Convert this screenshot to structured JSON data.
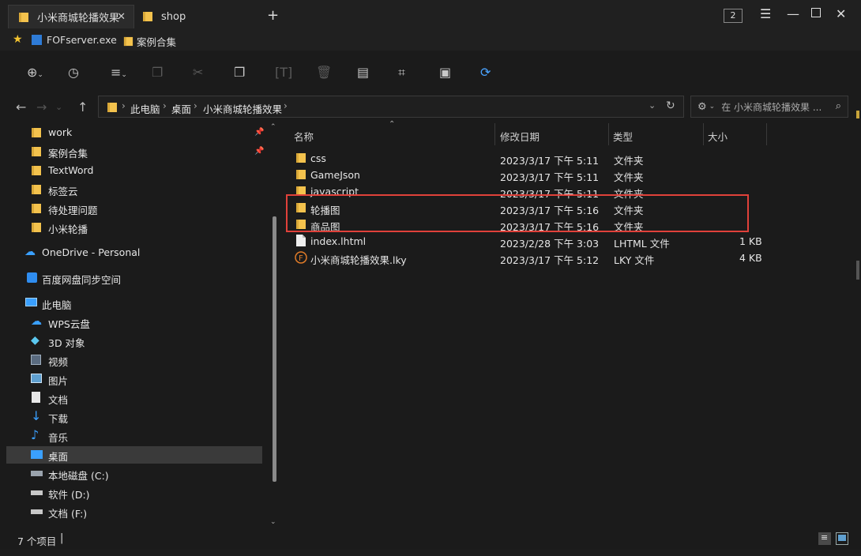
{
  "tabs": [
    {
      "label": "小米商城轮播效果"
    },
    {
      "label": "shop"
    }
  ],
  "window": {
    "count_badge": "2"
  },
  "bookmarks": [
    {
      "label": "FOFserver.exe"
    },
    {
      "label": "案例合集"
    }
  ],
  "breadcrumbs": [
    "此电脑",
    "桌面",
    "小米商城轮播效果"
  ],
  "search": {
    "placeholder": "在 小米商城轮播效果 ..."
  },
  "sidebar": {
    "items": [
      {
        "label": "work",
        "pinned": true
      },
      {
        "label": "案例合集",
        "pinned": true
      },
      {
        "label": "TextWord"
      },
      {
        "label": "标签云"
      },
      {
        "label": "待处理问题"
      },
      {
        "label": "小米轮播"
      },
      {
        "label": "OneDrive - Personal"
      },
      {
        "label": "百度网盘同步空间"
      },
      {
        "label": "此电脑"
      },
      {
        "label": "WPS云盘"
      },
      {
        "label": "3D 对象"
      },
      {
        "label": "视频"
      },
      {
        "label": "图片"
      },
      {
        "label": "文档"
      },
      {
        "label": "下载"
      },
      {
        "label": "音乐"
      },
      {
        "label": "桌面",
        "selected": true
      },
      {
        "label": "本地磁盘 (C:)"
      },
      {
        "label": "软件 (D:)"
      },
      {
        "label": "文档 (F:)"
      }
    ]
  },
  "columns": {
    "name": "名称",
    "date": "修改日期",
    "type": "类型",
    "size": "大小"
  },
  "files": [
    {
      "name": "css",
      "date": "2023/3/17 下午 5:11",
      "type": "文件夹",
      "size": "",
      "icon": "folder-icon"
    },
    {
      "name": "GameJson",
      "date": "2023/3/17 下午 5:11",
      "type": "文件夹",
      "size": "",
      "icon": "folder-icon"
    },
    {
      "name": "javascript",
      "date": "2023/3/17 下午 5:11",
      "type": "文件夹",
      "size": "",
      "icon": "folder-icon"
    },
    {
      "name": "轮播图",
      "date": "2023/3/17 下午 5:16",
      "type": "文件夹",
      "size": "",
      "icon": "folder-icon"
    },
    {
      "name": "商品图",
      "date": "2023/3/17 下午 5:16",
      "type": "文件夹",
      "size": "",
      "icon": "folder-icon"
    },
    {
      "name": "index.lhtml",
      "date": "2023/2/28 下午 3:03",
      "type": "LHTML 文件",
      "size": "1 KB",
      "icon": "file-icon"
    },
    {
      "name": "小米商城轮播效果.lky",
      "date": "2023/3/17 下午 5:12",
      "type": "LKY 文件",
      "size": "4 KB",
      "icon": "lky-file-icon"
    }
  ],
  "status": {
    "item_count": "7 个项目"
  },
  "colors": {
    "highlight": "#e0413a",
    "folder": "#f3c24d",
    "accent": "#3aa0ff"
  }
}
